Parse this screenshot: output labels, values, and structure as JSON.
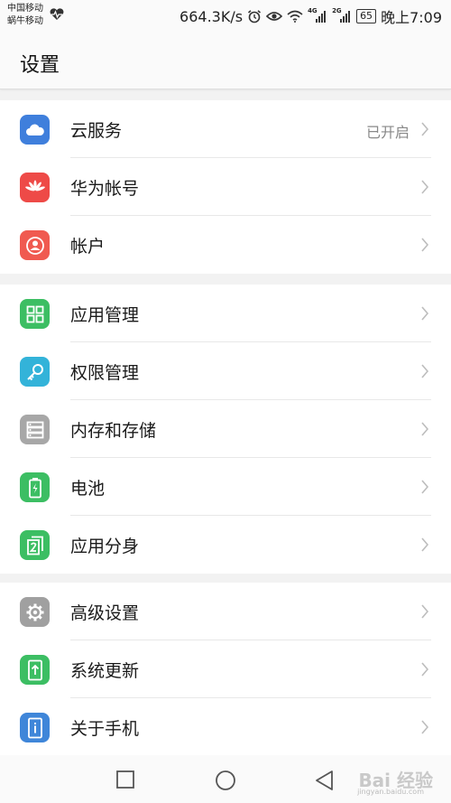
{
  "status": {
    "carrier1": "中国移动",
    "carrier2": "蜗牛移动",
    "speed": "664.3K/s",
    "net1": "4G",
    "net2": "2G",
    "battery": "65",
    "time": "晚上7:09"
  },
  "header": {
    "title": "设置"
  },
  "groups": [
    [
      {
        "label": "云服务",
        "value": "已开启",
        "icon": "cloud-icon",
        "color": "#3f7fdc"
      },
      {
        "label": "华为帐号",
        "icon": "huawei-logo-icon",
        "color": "#ee4a47"
      },
      {
        "label": "帐户",
        "icon": "user-icon",
        "color": "#f05a50"
      }
    ],
    [
      {
        "label": "应用管理",
        "icon": "apps-grid-icon",
        "color": "#3cbe63"
      },
      {
        "label": "权限管理",
        "icon": "key-icon",
        "color": "#33b3d9"
      },
      {
        "label": "内存和存储",
        "icon": "storage-icon",
        "color": "#a7a7a7"
      },
      {
        "label": "电池",
        "icon": "battery-icon",
        "color": "#3cbe63"
      },
      {
        "label": "应用分身",
        "icon": "app-twin-icon",
        "color": "#3cbe63"
      }
    ],
    [
      {
        "label": "高级设置",
        "icon": "gear-icon",
        "color": "#a0a0a0"
      },
      {
        "label": "系统更新",
        "icon": "system-update-icon",
        "color": "#3cbe63"
      },
      {
        "label": "关于手机",
        "icon": "phone-info-icon",
        "color": "#3f86d9"
      }
    ]
  ],
  "watermark": {
    "main": "Bai 经验",
    "sub": "jingyan.baidu.com"
  }
}
